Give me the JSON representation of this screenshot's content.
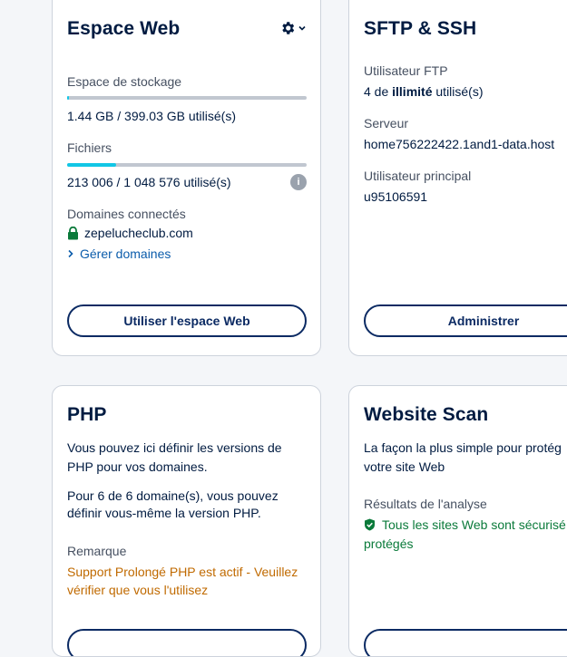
{
  "webspace": {
    "title": "Espace Web",
    "storage_label": "Espace de stockage",
    "storage_value": "1.44 GB / 399.03 GB utilisé(s)",
    "storage_fraction": 0.0036,
    "files_label": "Fichiers",
    "files_value": "213 006 / 1 048 576 utilisé(s)",
    "files_fraction": 0.203,
    "info_icon": "i",
    "domains_label": "Domaines connectés",
    "domain": "zepelucheclub.com",
    "manage_link": "Gérer domaines",
    "button": "Utiliser l'espace Web"
  },
  "sftp": {
    "title": "SFTP & SSH",
    "ftp_label": "Utilisateur FTP",
    "ftp_prefix": "4 de ",
    "ftp_bold": "illimité",
    "ftp_suffix": " utilisé(s)",
    "server_label": "Serveur",
    "server_value": "home756222422.1and1-data.host",
    "main_user_label": "Utilisateur principal",
    "main_user_value": "u95106591",
    "button": "Administrer"
  },
  "php": {
    "title": "PHP",
    "desc_line1": "Vous pouvez ici définir les versions de",
    "desc_line2": "PHP pour vos domaines.",
    "count_line1": "Pour 6 de 6 domaine(s), vous pouvez",
    "count_line2": "définir vous-même la version PHP.",
    "note_label": "Remarque",
    "note_line1": "Support Prolongé PHP est actif - Veuillez",
    "note_line2": "vérifier que vous l'utilisez"
  },
  "scan": {
    "title": "Website Scan",
    "desc_line1": "La façon la plus simple pour protég",
    "desc_line2": "votre site Web",
    "results_label": "Résultats de l'analyse",
    "result_line1": "Tous les sites Web sont sécurisé",
    "result_line2": "protégés"
  },
  "colors": {
    "accent": "#11c7e6",
    "button_border": "#0b2a63",
    "success": "#0a7a3a",
    "warning": "#c06a00",
    "link": "#0b5cab"
  }
}
